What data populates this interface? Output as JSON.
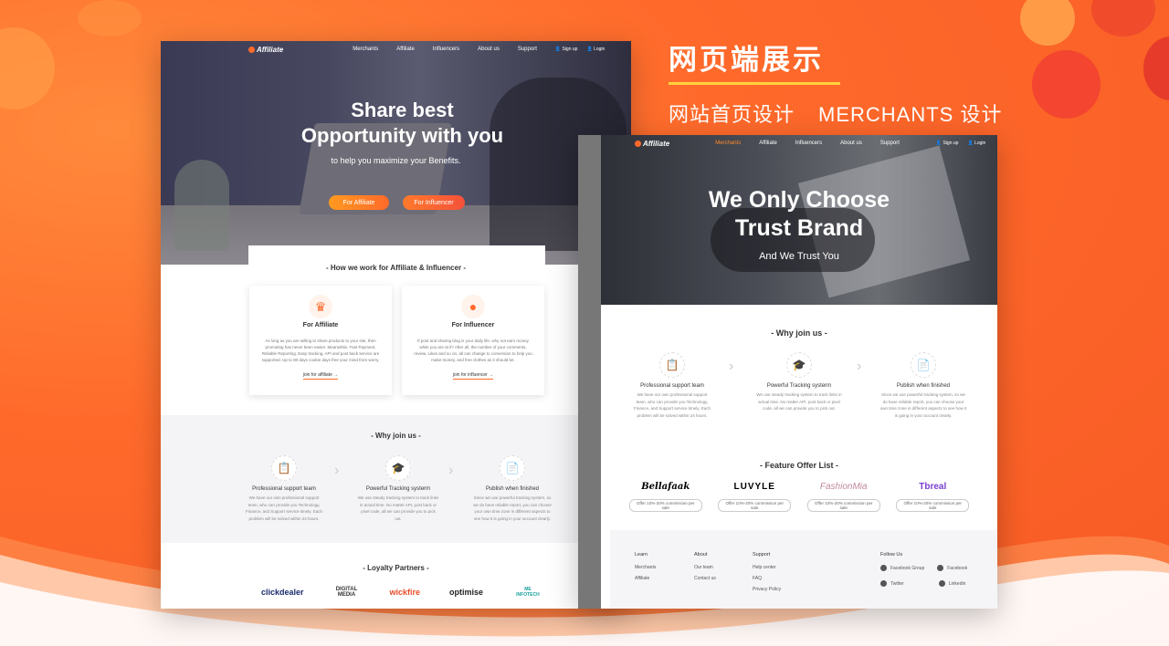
{
  "heading": {
    "title": "网页端展示",
    "subtitles": [
      "网站首页设计",
      "MERCHANTS 设计"
    ]
  },
  "homepage": {
    "nav": {
      "logo": "Affiliate",
      "links": [
        "Merchants",
        "Affiliate",
        "Influencers",
        "About us",
        "Support"
      ],
      "signup": "Sign up",
      "login": "Login"
    },
    "hero": {
      "title_line1": "Share best",
      "title_line2": "Opportunity with you",
      "subtitle": "to help you maximize your Benefits.",
      "btn_affiliate": "For Affiliate",
      "btn_influencer": "For Influencer"
    },
    "how_title": "- How we work for Affiliate & Influencer -",
    "cards": [
      {
        "title": "For Affiliate",
        "desc": "As long as you are willing to share products to your site, then promoting has never been easier. Meanwhile, Fast Payment, Reliable Reporting, Easy tracking, API and post back service are supported. Up to 90 days cookie days free your mind from worry.",
        "link": "join for affiliate"
      },
      {
        "title": "For Influencer",
        "desc": "If post and sharing blog is your daily life, why not earn money while you are at it? After all, the number of your comments, review, Likes and so on, all can change to conversion to help you make money, and free clothes as it should be.",
        "link": "join for influencer"
      }
    ],
    "why_title": "- Why join us -",
    "features": [
      {
        "title": "Professional support team",
        "desc": "We have our own professional support team, who can provide you Technology, Finance, and Support service timely. Each problem will be solved within 24 hours."
      },
      {
        "title": "Powerful Tracking systerm",
        "desc": "We use steady tracking system to track links in actual time. No matter API, post back or pixel code, all we can provide you to pick out."
      },
      {
        "title": "Publish when finished",
        "desc": "Since we use powerful tracking system, so we do have reliable report, you can choose your own time zone in different aspects to see how it is going in your account clearly."
      }
    ],
    "partners_title": "- Loyalty Partners -",
    "partners": [
      "clickdealer",
      "DIGITAL MEDIA",
      "wickfire",
      "optimise",
      "ME INFOTECH"
    ]
  },
  "merchants": {
    "nav": {
      "logo": "Affiliate",
      "links": [
        "Merchants",
        "Affiliate",
        "Influencers",
        "About us",
        "Support"
      ],
      "signup": "Sign up",
      "login": "Login"
    },
    "hero": {
      "title_line1": "We Only Choose",
      "title_line2": "Trust Brand",
      "subtitle": "And We Trust You"
    },
    "why_title": "- Why join us -",
    "offer_title": "- Feature Offer List -",
    "offers": [
      {
        "brand": "Bellafaak",
        "tag": "Offer 10%-20% commission per sale"
      },
      {
        "brand": "LUVYLE",
        "tag": "Offer 10%-20% commission per sale"
      },
      {
        "brand": "FashionMia",
        "tag": "Offer 10%-20% commission per sale"
      },
      {
        "brand": "Tbreal",
        "tag": "Offer 10%-20% commission per sale"
      }
    ],
    "footer": {
      "learn": {
        "head": "Learn",
        "items": [
          "Merchants",
          "Affiliate"
        ]
      },
      "about": {
        "head": "About",
        "items": [
          "Our team",
          "Contact us"
        ]
      },
      "support": {
        "head": "Support",
        "items": [
          "Help center",
          "FAQ",
          "Privacy Policy"
        ]
      },
      "follow": {
        "head": "Follow Us",
        "items": [
          "Facebook Group",
          "Facebook",
          "Twitter",
          "Linkedin"
        ]
      }
    }
  }
}
